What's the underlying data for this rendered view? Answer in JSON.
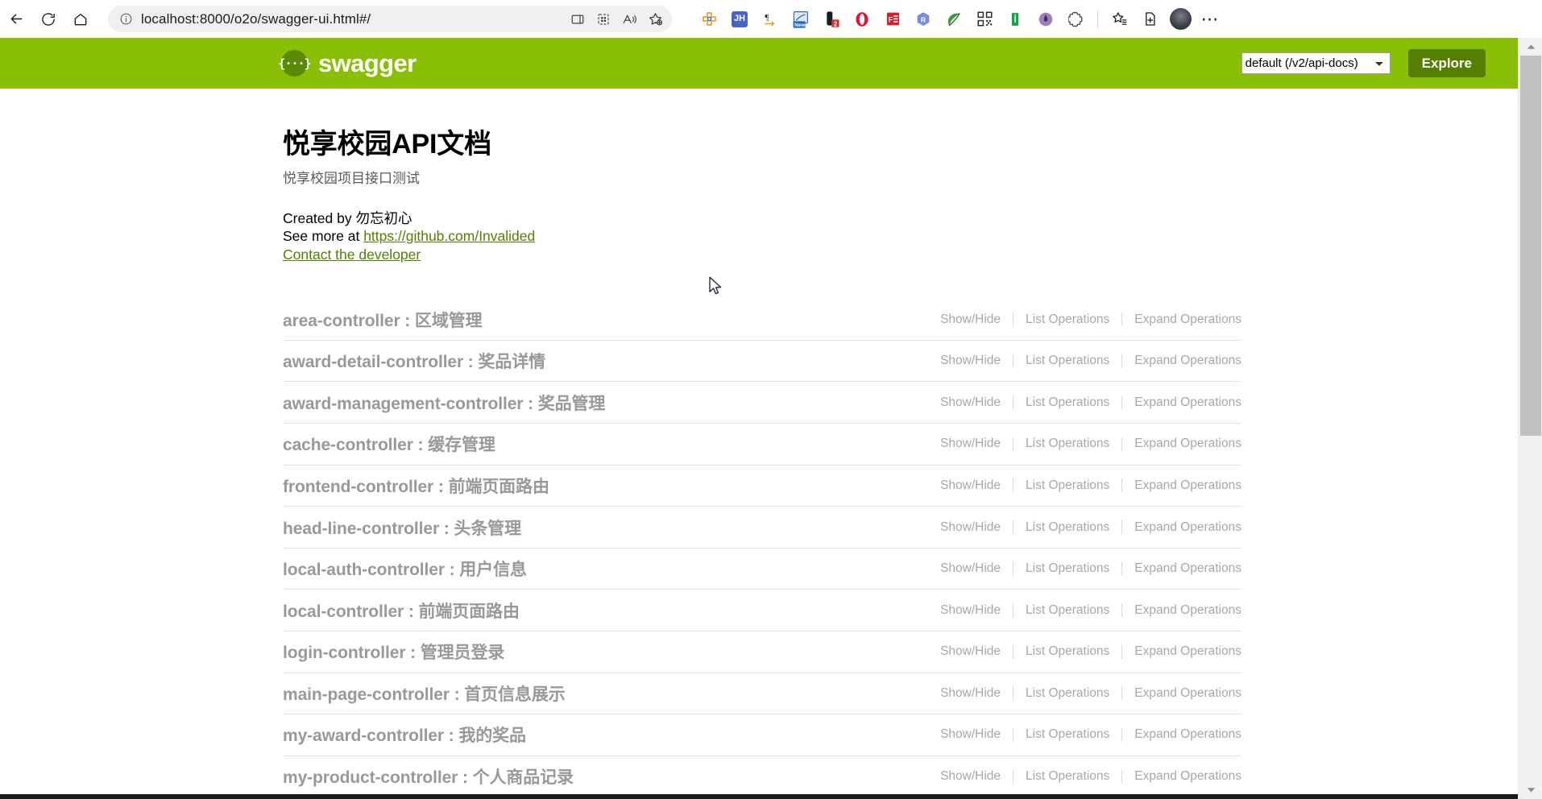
{
  "browser": {
    "back_icon": "back-arrow-icon",
    "reload_icon": "reload-icon",
    "home_icon": "home-icon",
    "info_icon": "site-info-icon",
    "url": "localhost:8000/o2o/swagger-ui.html#/",
    "omnibox_icons": [
      "split-screen-icon",
      "collections-icon",
      "read-aloud-icon",
      "add-favorite-icon"
    ],
    "extensions": [
      {
        "name": "extension-plus-icon",
        "label": "",
        "color": "#ffffff"
      },
      {
        "name": "extension-jh-icon",
        "label": "JH",
        "color": "#4a63c8"
      },
      {
        "name": "extension-pilcrow-icon",
        "label": "¶",
        "color": "#ffffff"
      },
      {
        "name": "extension-new-icon",
        "label": "New",
        "color": "#1668c1"
      },
      {
        "name": "extension-capsule-icon",
        "label": "2",
        "color": "#e02b2b"
      },
      {
        "name": "extension-opera-icon",
        "label": "",
        "color": "#e8112d"
      },
      {
        "name": "extension-fe-icon",
        "label": "FE",
        "color": "#e01b24"
      },
      {
        "name": "extension-r-icon",
        "label": "R",
        "color": "#7a8ce0"
      },
      {
        "name": "extension-leaf-icon",
        "label": "",
        "color": "#3a9a3a"
      },
      {
        "name": "extension-qr-icon",
        "label": "",
        "color": "#2b2b2b"
      },
      {
        "name": "extension-info-bar-icon",
        "label": "i",
        "color": "#16a34a"
      },
      {
        "name": "extension-purple-icon",
        "label": "",
        "color": "#9b7fb8"
      },
      {
        "name": "extension-puzzle-icon",
        "label": "",
        "color": "#444444"
      }
    ],
    "favorites_icon": "favorites-icon",
    "collections_icon": "collections-add-icon",
    "profile_avatar": "profile-avatar",
    "settings_more_icon": "more-options-icon"
  },
  "swagger_header": {
    "logo_glyph": "{···}",
    "logo_text": "swagger",
    "api_select_value": "default (/v2/api-docs)",
    "api_select_options": [
      "default (/v2/api-docs)"
    ],
    "explore_label": "Explore",
    "bar_color": "#89bf04",
    "explore_color": "#547f00"
  },
  "info": {
    "title": "悦享校园API文档",
    "subtitle": "悦享校园项目接口测试",
    "created_by_prefix": "Created by ",
    "created_by_name": "勿忘初心",
    "see_more_prefix": "See more at ",
    "see_more_link": "https://github.com/Invalided",
    "contact_link": "Contact the developer",
    "link_color": "#547f00"
  },
  "operations_labels": {
    "show_hide": "Show/Hide",
    "list_operations": "List Operations",
    "expand_operations": "Expand Operations"
  },
  "resources": [
    {
      "name": "area-controller : 区域管理"
    },
    {
      "name": "award-detail-controller : 奖品详情"
    },
    {
      "name": "award-management-controller : 奖品管理"
    },
    {
      "name": "cache-controller : 缓存管理"
    },
    {
      "name": "frontend-controller : 前端页面路由"
    },
    {
      "name": "head-line-controller : 头条管理"
    },
    {
      "name": "local-auth-controller : 用户信息"
    },
    {
      "name": "local-controller : 前端页面路由"
    },
    {
      "name": "login-controller : 管理员登录"
    },
    {
      "name": "main-page-controller : 首页信息展示"
    },
    {
      "name": "my-award-controller : 我的奖品"
    },
    {
      "name": "my-product-controller : 个人商品记录"
    }
  ],
  "scrollbar": {
    "up_arrow": "▲",
    "down_arrow": "▼"
  }
}
